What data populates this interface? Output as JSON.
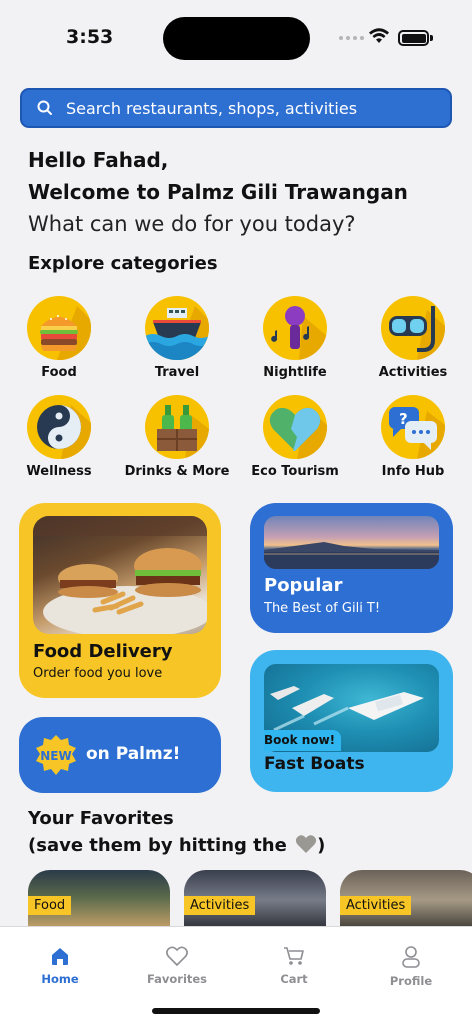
{
  "status": {
    "time": "3:53"
  },
  "search": {
    "placeholder": "Search restaurants, shops, activities"
  },
  "greeting": {
    "line1": "Hello Fahad,",
    "line2": "Welcome to Palmz Gili Trawangan",
    "line3": "What can we do for you today?"
  },
  "categories": {
    "title": "Explore categories",
    "items": [
      {
        "label": "Food",
        "icon": "burger-icon"
      },
      {
        "label": "Travel",
        "icon": "ship-icon"
      },
      {
        "label": "Nightlife",
        "icon": "microphone-icon"
      },
      {
        "label": "Activities",
        "icon": "snorkel-mask-icon"
      },
      {
        "label": "Wellness",
        "icon": "yin-yang-icon"
      },
      {
        "label": "Drinks & More",
        "icon": "bottles-icon"
      },
      {
        "label": "Eco Tourism",
        "icon": "leaf-heart-icon"
      },
      {
        "label": "Info Hub",
        "icon": "chat-question-icon"
      }
    ]
  },
  "promo": {
    "food": {
      "title": "Food Delivery",
      "subtitle": "Order food you love"
    },
    "popular": {
      "title": "Popular",
      "subtitle": "The Best of Gili T!"
    },
    "boats": {
      "badge": "Book now!",
      "title": "Fast Boats"
    },
    "new": {
      "badge": "NEW",
      "text": "on Palmz!"
    }
  },
  "favorites": {
    "line1": "Your Favorites",
    "line2_prefix": "(save them by hitting the ",
    "line2_suffix": ")",
    "cards": [
      {
        "tag": "Food"
      },
      {
        "tag": "Activities"
      },
      {
        "tag": "Activities"
      }
    ]
  },
  "tabbar": {
    "items": [
      {
        "label": "Home",
        "icon": "home-icon",
        "active": true
      },
      {
        "label": "Favorites",
        "icon": "heart-icon",
        "active": false
      },
      {
        "label": "Cart",
        "icon": "cart-icon",
        "active": false
      },
      {
        "label": "Profile",
        "icon": "person-icon",
        "active": false
      }
    ]
  },
  "colors": {
    "primary_blue": "#2d6fd2",
    "accent_yellow": "#f7c626",
    "light_blue": "#3fb5ef",
    "background": "#f2f2f4"
  }
}
